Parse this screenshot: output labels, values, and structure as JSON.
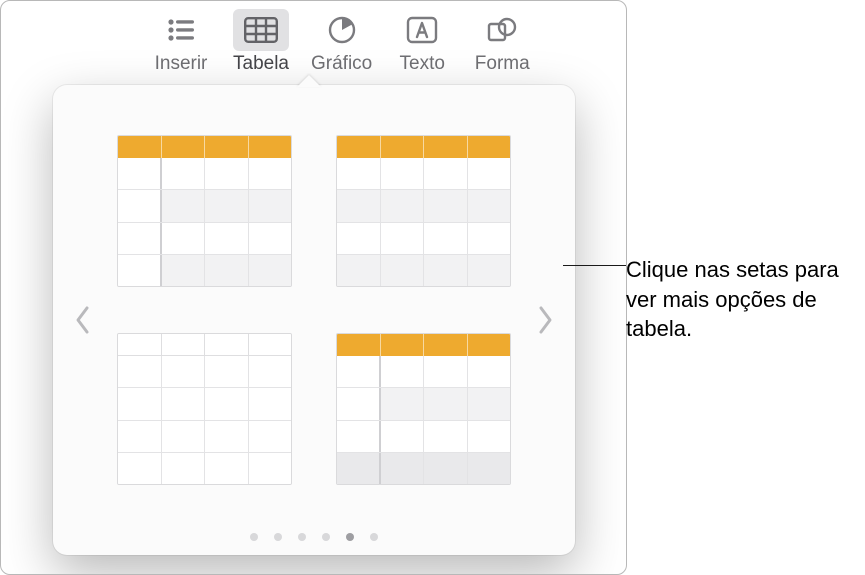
{
  "toolbar": {
    "items": [
      {
        "label": "Inserir",
        "icon": "list-bullet"
      },
      {
        "label": "Tabela",
        "icon": "table",
        "active": true
      },
      {
        "label": "Gráfico",
        "icon": "pie"
      },
      {
        "label": "Texto",
        "icon": "textbox"
      },
      {
        "label": "Forma",
        "icon": "shapes"
      }
    ]
  },
  "popover": {
    "page_count": 6,
    "active_page_index": 4,
    "styles": [
      {
        "id": "orange-header-rowhead-banded"
      },
      {
        "id": "orange-header-banded"
      },
      {
        "id": "plain-grid"
      },
      {
        "id": "orange-header-rowhead-footer"
      }
    ]
  },
  "callout": {
    "text": "Clique nas setas para ver mais opções de tabela."
  }
}
